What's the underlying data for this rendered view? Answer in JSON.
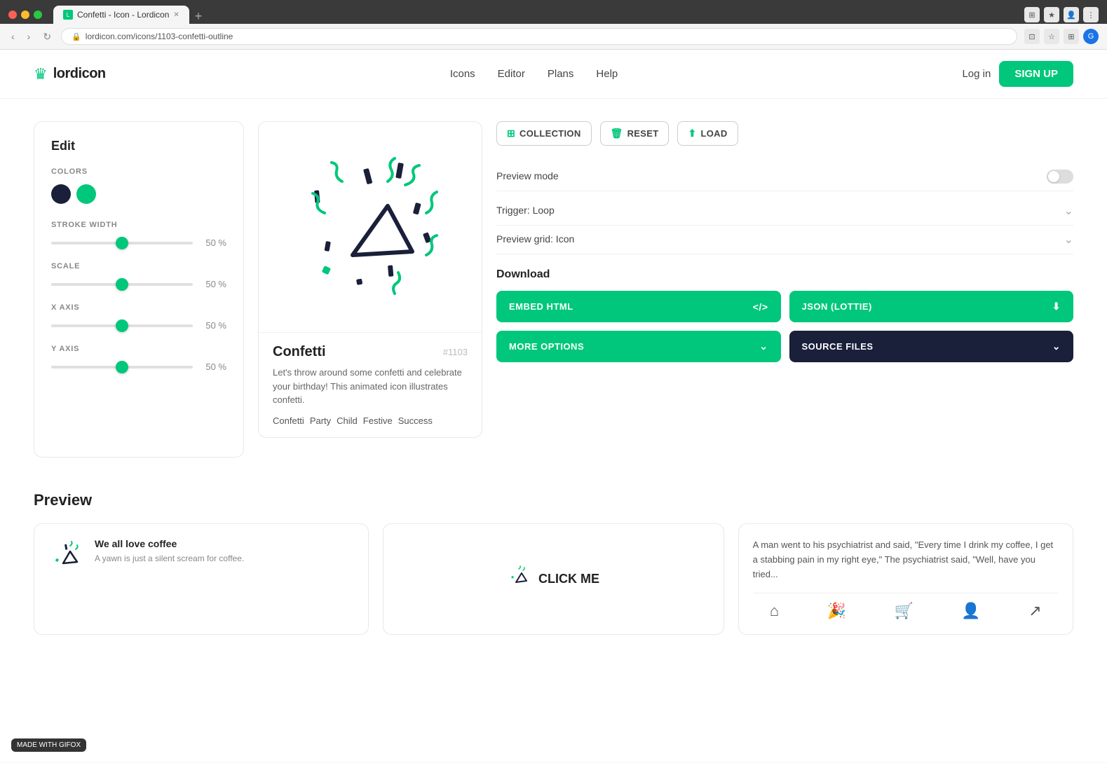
{
  "browser": {
    "tab_title": "Confetti - Icon - Lordicon",
    "url": "lordicon.com/icons/1103-confetti-outline",
    "new_tab_label": "+"
  },
  "header": {
    "logo_text": "lordicon",
    "nav_items": [
      "Icons",
      "Editor",
      "Plans",
      "Help"
    ],
    "login_label": "Log in",
    "signup_label": "SIGN UP"
  },
  "edit_panel": {
    "title": "Edit",
    "colors_label": "COLORS",
    "stroke_label": "STROKE WIDTH",
    "stroke_value": "50 %",
    "scale_label": "SCALE",
    "scale_value": "50 %",
    "x_axis_label": "X AXIS",
    "x_axis_value": "50 %",
    "y_axis_label": "Y AXIS",
    "y_axis_value": "50 %"
  },
  "icon_info": {
    "name": "Confetti",
    "id": "#1103",
    "description": "Let's throw around some confetti and celebrate your birthday! This animated icon illustrates confetti.",
    "tags": [
      "Confetti",
      "Party",
      "Child",
      "Festive",
      "Success"
    ]
  },
  "controls": {
    "collection_label": "COLLECTION",
    "reset_label": "RESET",
    "load_label": "LOAD",
    "preview_mode_label": "Preview mode",
    "trigger_label": "Trigger: Loop",
    "preview_grid_label": "Preview grid: Icon",
    "download_title": "Download",
    "embed_html_label": "EMBED HTML",
    "json_lottie_label": "JSON (LOTTIE)",
    "more_options_label": "MORE OPTIONS",
    "source_files_label": "SOURCE FILES"
  },
  "preview_section": {
    "title": "Preview",
    "card1": {
      "heading": "We all love coffee",
      "text": "A yawn is just a silent scream for coffee."
    },
    "card2": {
      "click_label": "CLICK ME"
    },
    "card3": {
      "text": "A man went to his psychiatrist and said, \"Every time I drink my coffee, I get a stabbing pain in my right eye,\" The psychiatrist said, \"Well, have you tried..."
    }
  },
  "gifox": {
    "label": "MADE WITH GIFOX"
  }
}
